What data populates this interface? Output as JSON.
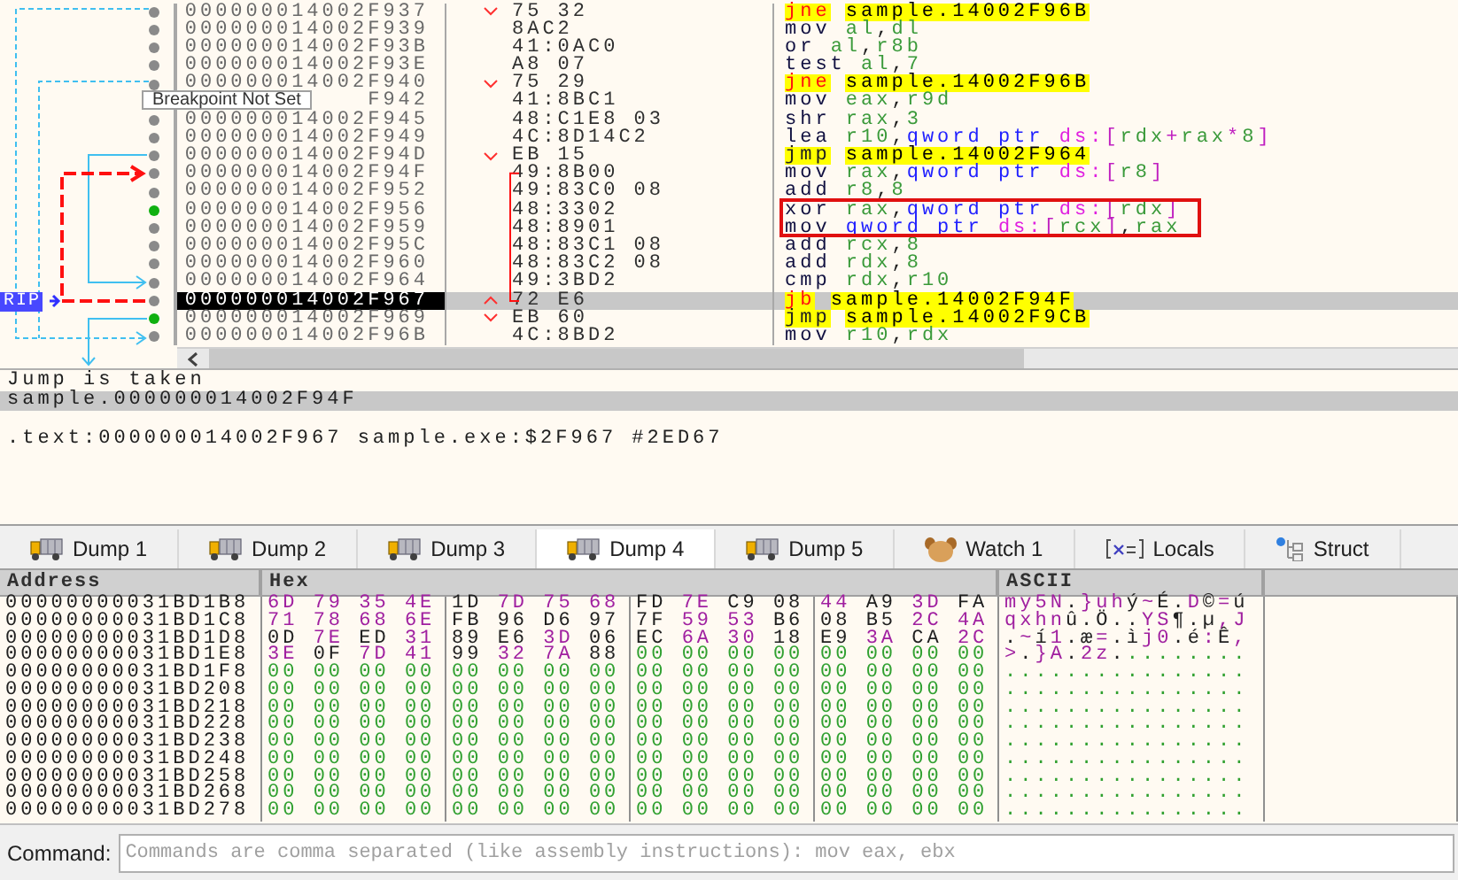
{
  "disassembly": {
    "tooltip": "Breakpoint Not Set",
    "rip_label": "RIP",
    "rows": [
      {
        "address": "000000014002F937",
        "bytes": "75 32",
        "mnemonic": "jne",
        "operands": "sample.14002F96B",
        "kind": "cond_jump",
        "jump_up": false,
        "jump_down": true,
        "breakpoint": false,
        "selected": false,
        "boxed": false
      },
      {
        "address": "000000014002F939",
        "bytes": "8AC2",
        "mnemonic": "mov",
        "operands": "al,dl",
        "kind": "plain",
        "jump_up": false,
        "jump_down": false,
        "breakpoint": false,
        "selected": false,
        "boxed": false
      },
      {
        "address": "000000014002F93B",
        "bytes": "41:0AC0",
        "mnemonic": "or",
        "operands": "al,r8b",
        "kind": "plain",
        "jump_up": false,
        "jump_down": false,
        "breakpoint": false,
        "selected": false,
        "boxed": false
      },
      {
        "address": "000000014002F93E",
        "bytes": "A8 07",
        "mnemonic": "test",
        "operands": "al,7",
        "kind": "plain",
        "jump_up": false,
        "jump_down": false,
        "breakpoint": false,
        "selected": false,
        "boxed": false
      },
      {
        "address": "000000014002F940",
        "bytes": "75 29",
        "mnemonic": "jne",
        "operands": "sample.14002F96B",
        "kind": "cond_jump",
        "jump_up": false,
        "jump_down": true,
        "breakpoint": false,
        "selected": false,
        "boxed": false
      },
      {
        "address": "F942",
        "bytes": "41:8BC1",
        "mnemonic": "mov",
        "operands": "eax,r9d",
        "kind": "plain",
        "jump_up": false,
        "jump_down": false,
        "selected": false,
        "boxed": false
      },
      {
        "address": "000000014002F945",
        "bytes": "48:C1E8 03",
        "mnemonic": "shr",
        "operands": "rax,3",
        "kind": "plain",
        "jump_up": false,
        "jump_down": false,
        "breakpoint": false,
        "selected": false,
        "boxed": false
      },
      {
        "address": "000000014002F949",
        "bytes": "4C:8D14C2",
        "mnemonic": "lea",
        "operands": "r10,qword ptr ds:[rdx+rax*8]",
        "kind": "plain",
        "jump_up": false,
        "jump_down": false,
        "breakpoint": false,
        "selected": false,
        "boxed": false
      },
      {
        "address": "000000014002F94D",
        "bytes": "EB 15",
        "mnemonic": "jmp",
        "operands": "sample.14002F964",
        "kind": "jump",
        "jump_up": false,
        "jump_down": true,
        "breakpoint": false,
        "selected": false,
        "boxed": false
      },
      {
        "address": "000000014002F94F",
        "bytes": "49:8B00",
        "mnemonic": "mov",
        "operands": "rax,qword ptr ds:[r8]",
        "kind": "plain",
        "jump_up": false,
        "jump_down": false,
        "breakpoint": false,
        "selected": false,
        "boxed": false
      },
      {
        "address": "000000014002F952",
        "bytes": "49:83C0 08",
        "mnemonic": "add",
        "operands": "r8,8",
        "kind": "plain",
        "jump_up": false,
        "jump_down": false,
        "breakpoint": false,
        "selected": false,
        "boxed": false
      },
      {
        "address": "000000014002F956",
        "bytes": "48:3302",
        "mnemonic": "xor",
        "operands": "rax,qword ptr ds:[rdx]",
        "kind": "plain",
        "jump_up": false,
        "jump_down": false,
        "breakpoint": true,
        "selected": false,
        "boxed": true
      },
      {
        "address": "000000014002F959",
        "bytes": "48:8901",
        "mnemonic": "mov",
        "operands": "qword ptr ds:[rcx],rax",
        "kind": "plain",
        "jump_up": false,
        "jump_down": false,
        "breakpoint": false,
        "selected": false,
        "boxed": true
      },
      {
        "address": "000000014002F95C",
        "bytes": "48:83C1 08",
        "mnemonic": "add",
        "operands": "rcx,8",
        "kind": "plain",
        "jump_up": false,
        "jump_down": false,
        "breakpoint": false,
        "selected": false,
        "boxed": false
      },
      {
        "address": "000000014002F960",
        "bytes": "48:83C2 08",
        "mnemonic": "add",
        "operands": "rdx,8",
        "kind": "plain",
        "jump_up": false,
        "jump_down": false,
        "breakpoint": false,
        "selected": false,
        "boxed": false
      },
      {
        "address": "000000014002F964",
        "bytes": "49:3BD2",
        "mnemonic": "cmp",
        "operands": "rdx,r10",
        "kind": "plain",
        "jump_up": false,
        "jump_down": false,
        "breakpoint": false,
        "selected": false,
        "boxed": false
      },
      {
        "address": "000000014002F967",
        "bytes": "72 E6",
        "mnemonic": "jb",
        "operands": "sample.14002F94F",
        "kind": "cond_jump",
        "jump_up": true,
        "jump_down": false,
        "breakpoint": false,
        "selected": true,
        "boxed": false
      },
      {
        "address": "000000014002F969",
        "bytes": "EB 60",
        "mnemonic": "jmp",
        "operands": "sample.14002F9CB",
        "kind": "jump",
        "jump_up": false,
        "jump_down": true,
        "breakpoint": true,
        "selected": false,
        "boxed": false
      },
      {
        "address": "000000014002F96B",
        "bytes": "4C:8BD2",
        "mnemonic": "mov",
        "operands": "r10,rdx",
        "kind": "plain",
        "jump_up": false,
        "jump_down": false,
        "breakpoint": false,
        "selected": false,
        "boxed": false
      }
    ]
  },
  "info": {
    "branch_status": "Jump is taken",
    "target": "sample.000000014002F94F",
    "location": ".text:000000014002F967 sample.exe:$2F967 #2ED67"
  },
  "tabs": [
    {
      "label": "Dump 1",
      "kind": "dump",
      "selected": false
    },
    {
      "label": "Dump 2",
      "kind": "dump",
      "selected": false
    },
    {
      "label": "Dump 3",
      "kind": "dump",
      "selected": false
    },
    {
      "label": "Dump 4",
      "kind": "dump",
      "selected": true
    },
    {
      "label": "Dump 5",
      "kind": "dump",
      "selected": false
    },
    {
      "label": "Watch 1",
      "kind": "watch",
      "selected": false
    },
    {
      "label": "Locals",
      "kind": "locals",
      "selected": false
    },
    {
      "label": "Struct",
      "kind": "struct",
      "selected": false
    }
  ],
  "dump": {
    "columns": [
      "Address",
      "Hex",
      "ASCII"
    ],
    "rows": [
      {
        "address": "00000000031BD1B8",
        "bytes": [
          "6D 79 35 4E",
          "1D 7D 75 68",
          "FD 7E C9 08",
          "44 A9 3D FA"
        ],
        "ascii": "my5N.}uhý~É.D©=ú"
      },
      {
        "address": "00000000031BD1C8",
        "bytes": [
          "71 78 68 6E",
          "FB 96 D6 97",
          "7F 59 53 B6",
          "08 B5 2C 4A"
        ],
        "ascii": "qxhnû.Ö..YS¶.µ,J"
      },
      {
        "address": "00000000031BD1D8",
        "bytes": [
          "0D 7E ED 31",
          "89 E6 3D 06",
          "EC 6A 30 18",
          "E9 3A CA 2C"
        ],
        "ascii": ".~í1.æ=.ìj0.é:Ê,"
      },
      {
        "address": "00000000031BD1E8",
        "bytes": [
          "3E 0F 7D 41",
          "99 32 7A 88",
          "00 00 00 00",
          "00 00 00 00"
        ],
        "ascii": ">.}A.2z........."
      },
      {
        "address": "00000000031BD1F8",
        "bytes": [
          "00 00 00 00",
          "00 00 00 00",
          "00 00 00 00",
          "00 00 00 00"
        ],
        "ascii": "................"
      },
      {
        "address": "00000000031BD208",
        "bytes": [
          "00 00 00 00",
          "00 00 00 00",
          "00 00 00 00",
          "00 00 00 00"
        ],
        "ascii": "................"
      },
      {
        "address": "00000000031BD218",
        "bytes": [
          "00 00 00 00",
          "00 00 00 00",
          "00 00 00 00",
          "00 00 00 00"
        ],
        "ascii": "................"
      },
      {
        "address": "00000000031BD228",
        "bytes": [
          "00 00 00 00",
          "00 00 00 00",
          "00 00 00 00",
          "00 00 00 00"
        ],
        "ascii": "................"
      },
      {
        "address": "00000000031BD238",
        "bytes": [
          "00 00 00 00",
          "00 00 00 00",
          "00 00 00 00",
          "00 00 00 00"
        ],
        "ascii": "................"
      },
      {
        "address": "00000000031BD248",
        "bytes": [
          "00 00 00 00",
          "00 00 00 00",
          "00 00 00 00",
          "00 00 00 00"
        ],
        "ascii": "................"
      },
      {
        "address": "00000000031BD258",
        "bytes": [
          "00 00 00 00",
          "00 00 00 00",
          "00 00 00 00",
          "00 00 00 00"
        ],
        "ascii": "................"
      },
      {
        "address": "00000000031BD268",
        "bytes": [
          "00 00 00 00",
          "00 00 00 00",
          "00 00 00 00",
          "00 00 00 00"
        ],
        "ascii": "................"
      },
      {
        "address": "00000000031BD278",
        "bytes": [
          "00 00 00 00",
          "00 00 00 00",
          "00 00 00 00",
          "00 00 00 00"
        ],
        "ascii": "................"
      }
    ]
  },
  "command": {
    "label": "Command:",
    "placeholder": "Commands are comma separated (like assembly instructions): mov eax, ebx"
  }
}
